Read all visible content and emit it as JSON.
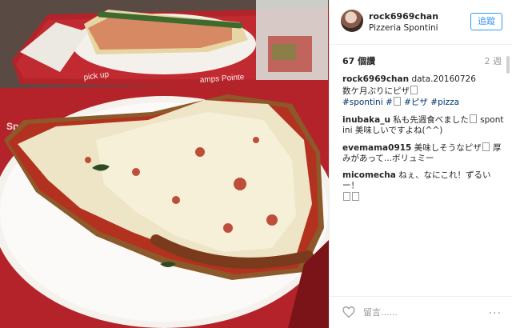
{
  "post": {
    "username": "rock6969chan",
    "location": "Pizzeria Spontini",
    "follow_label": "追蹤",
    "likes": "67 個讚",
    "time": "2 週",
    "photo_tray_text_top": "pick up",
    "photo_tray_text_mid": "amps Pointe",
    "photo_tray_text_left": "Sp"
  },
  "comments": [
    {
      "user": "rock6969chan",
      "text": "data.20160726"
    },
    {
      "user": "",
      "text": "数ケ月ぶりにピザ"
    },
    {
      "user": "",
      "text_tags": [
        "#spontini",
        "#",
        "#ピザ",
        "#pizza"
      ]
    },
    {
      "user": "inubaka_u",
      "text": "私も先週食べました",
      "mention": "spontini",
      "text2": "美味しいですよね(^^)"
    },
    {
      "user": "evemama0915",
      "text": "美味しそうなピザ",
      "text2": "厚みがあって...ボリュミー"
    },
    {
      "user": "micomecha",
      "text": "ねぇ、なにこれ！ずるいー！"
    }
  ],
  "footer": {
    "comment_placeholder": "留言......",
    "more": "..."
  }
}
